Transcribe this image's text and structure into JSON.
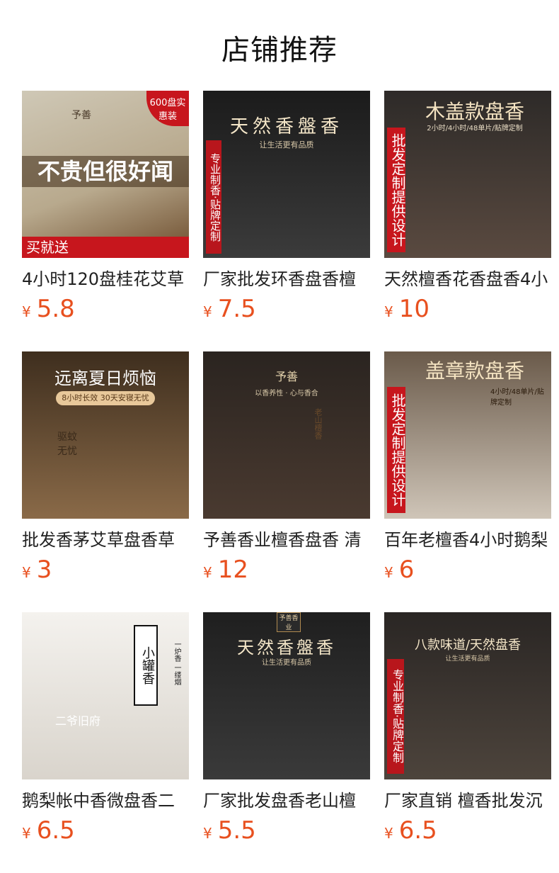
{
  "header": {
    "title": "店铺推荐"
  },
  "currency": "¥",
  "products": [
    {
      "name": "4小时120盘桂花艾草",
      "price": "5.8",
      "badge": "600盘实惠装",
      "overlay_main": "不贵但很好闻",
      "overlay_bottom": "买就送",
      "brand": "予善"
    },
    {
      "name": "厂家批发环香盘香檀",
      "price": "7.5",
      "overlay_title": "天然香盤香",
      "overlay_sub": "让生活更有品质",
      "side_text": "专业制香·贴牌定制"
    },
    {
      "name": "天然檀香花香盘香4小",
      "price": "10",
      "overlay_title": "木盖款盘香",
      "overlay_sub": "2小时/4小时/48单片/贴牌定制",
      "side_text": "批发定制提供设计"
    },
    {
      "name": "批发香茅艾草盘香草",
      "price": "3",
      "overlay_title": "远离夏日烦恼",
      "overlay_sub": "8小时长效 30天安寝无忧",
      "box_text": "驱蚊无忧"
    },
    {
      "name": "予善香业檀香盘香 清",
      "price": "12",
      "brand": "予善",
      "overlay_sub": "以香养性 · 心与香合",
      "box_text": "老山檀香"
    },
    {
      "name": "百年老檀香4小时鹅梨",
      "price": "6",
      "overlay_title": "盖章款盘香",
      "overlay_sub": "4小时/48单片/贴牌定制",
      "side_text": "批发定制提供设计"
    },
    {
      "name": "鹅梨帐中香微盘香二",
      "price": "6.5",
      "overlay_title": "小罐香",
      "overlay_sub": "一炉香 一缕烟",
      "tin_text": "二爷旧府"
    },
    {
      "name": "厂家批发盘香老山檀",
      "price": "5.5",
      "overlay_title": "天然香盤香",
      "overlay_sub": "让生活更有品质",
      "brand": "予善香业"
    },
    {
      "name": "厂家直销 檀香批发沉",
      "price": "6.5",
      "overlay_title": "八款味道/天然盘香",
      "overlay_sub": "让生活更有品质",
      "side_text": "专业制香·贴牌定制"
    }
  ],
  "colors": {
    "price": "#e8501f",
    "title": "#111111",
    "name": "#222222"
  }
}
